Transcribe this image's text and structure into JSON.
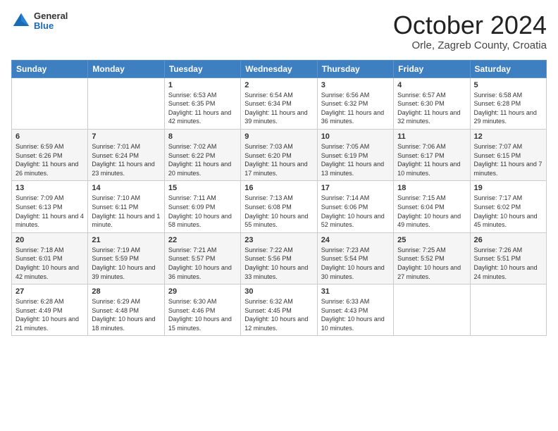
{
  "header": {
    "logo_general": "General",
    "logo_blue": "Blue",
    "month_title": "October 2024",
    "location": "Orle, Zagreb County, Croatia"
  },
  "days_of_week": [
    "Sunday",
    "Monday",
    "Tuesday",
    "Wednesday",
    "Thursday",
    "Friday",
    "Saturday"
  ],
  "weeks": [
    [
      {
        "day": "",
        "sunrise": "",
        "sunset": "",
        "daylight": ""
      },
      {
        "day": "",
        "sunrise": "",
        "sunset": "",
        "daylight": ""
      },
      {
        "day": "1",
        "sunrise": "Sunrise: 6:53 AM",
        "sunset": "Sunset: 6:35 PM",
        "daylight": "Daylight: 11 hours and 42 minutes."
      },
      {
        "day": "2",
        "sunrise": "Sunrise: 6:54 AM",
        "sunset": "Sunset: 6:34 PM",
        "daylight": "Daylight: 11 hours and 39 minutes."
      },
      {
        "day": "3",
        "sunrise": "Sunrise: 6:56 AM",
        "sunset": "Sunset: 6:32 PM",
        "daylight": "Daylight: 11 hours and 36 minutes."
      },
      {
        "day": "4",
        "sunrise": "Sunrise: 6:57 AM",
        "sunset": "Sunset: 6:30 PM",
        "daylight": "Daylight: 11 hours and 32 minutes."
      },
      {
        "day": "5",
        "sunrise": "Sunrise: 6:58 AM",
        "sunset": "Sunset: 6:28 PM",
        "daylight": "Daylight: 11 hours and 29 minutes."
      }
    ],
    [
      {
        "day": "6",
        "sunrise": "Sunrise: 6:59 AM",
        "sunset": "Sunset: 6:26 PM",
        "daylight": "Daylight: 11 hours and 26 minutes."
      },
      {
        "day": "7",
        "sunrise": "Sunrise: 7:01 AM",
        "sunset": "Sunset: 6:24 PM",
        "daylight": "Daylight: 11 hours and 23 minutes."
      },
      {
        "day": "8",
        "sunrise": "Sunrise: 7:02 AM",
        "sunset": "Sunset: 6:22 PM",
        "daylight": "Daylight: 11 hours and 20 minutes."
      },
      {
        "day": "9",
        "sunrise": "Sunrise: 7:03 AM",
        "sunset": "Sunset: 6:20 PM",
        "daylight": "Daylight: 11 hours and 17 minutes."
      },
      {
        "day": "10",
        "sunrise": "Sunrise: 7:05 AM",
        "sunset": "Sunset: 6:19 PM",
        "daylight": "Daylight: 11 hours and 13 minutes."
      },
      {
        "day": "11",
        "sunrise": "Sunrise: 7:06 AM",
        "sunset": "Sunset: 6:17 PM",
        "daylight": "Daylight: 11 hours and 10 minutes."
      },
      {
        "day": "12",
        "sunrise": "Sunrise: 7:07 AM",
        "sunset": "Sunset: 6:15 PM",
        "daylight": "Daylight: 11 hours and 7 minutes."
      }
    ],
    [
      {
        "day": "13",
        "sunrise": "Sunrise: 7:09 AM",
        "sunset": "Sunset: 6:13 PM",
        "daylight": "Daylight: 11 hours and 4 minutes."
      },
      {
        "day": "14",
        "sunrise": "Sunrise: 7:10 AM",
        "sunset": "Sunset: 6:11 PM",
        "daylight": "Daylight: 11 hours and 1 minute."
      },
      {
        "day": "15",
        "sunrise": "Sunrise: 7:11 AM",
        "sunset": "Sunset: 6:09 PM",
        "daylight": "Daylight: 10 hours and 58 minutes."
      },
      {
        "day": "16",
        "sunrise": "Sunrise: 7:13 AM",
        "sunset": "Sunset: 6:08 PM",
        "daylight": "Daylight: 10 hours and 55 minutes."
      },
      {
        "day": "17",
        "sunrise": "Sunrise: 7:14 AM",
        "sunset": "Sunset: 6:06 PM",
        "daylight": "Daylight: 10 hours and 52 minutes."
      },
      {
        "day": "18",
        "sunrise": "Sunrise: 7:15 AM",
        "sunset": "Sunset: 6:04 PM",
        "daylight": "Daylight: 10 hours and 49 minutes."
      },
      {
        "day": "19",
        "sunrise": "Sunrise: 7:17 AM",
        "sunset": "Sunset: 6:02 PM",
        "daylight": "Daylight: 10 hours and 45 minutes."
      }
    ],
    [
      {
        "day": "20",
        "sunrise": "Sunrise: 7:18 AM",
        "sunset": "Sunset: 6:01 PM",
        "daylight": "Daylight: 10 hours and 42 minutes."
      },
      {
        "day": "21",
        "sunrise": "Sunrise: 7:19 AM",
        "sunset": "Sunset: 5:59 PM",
        "daylight": "Daylight: 10 hours and 39 minutes."
      },
      {
        "day": "22",
        "sunrise": "Sunrise: 7:21 AM",
        "sunset": "Sunset: 5:57 PM",
        "daylight": "Daylight: 10 hours and 36 minutes."
      },
      {
        "day": "23",
        "sunrise": "Sunrise: 7:22 AM",
        "sunset": "Sunset: 5:56 PM",
        "daylight": "Daylight: 10 hours and 33 minutes."
      },
      {
        "day": "24",
        "sunrise": "Sunrise: 7:23 AM",
        "sunset": "Sunset: 5:54 PM",
        "daylight": "Daylight: 10 hours and 30 minutes."
      },
      {
        "day": "25",
        "sunrise": "Sunrise: 7:25 AM",
        "sunset": "Sunset: 5:52 PM",
        "daylight": "Daylight: 10 hours and 27 minutes."
      },
      {
        "day": "26",
        "sunrise": "Sunrise: 7:26 AM",
        "sunset": "Sunset: 5:51 PM",
        "daylight": "Daylight: 10 hours and 24 minutes."
      }
    ],
    [
      {
        "day": "27",
        "sunrise": "Sunrise: 6:28 AM",
        "sunset": "Sunset: 4:49 PM",
        "daylight": "Daylight: 10 hours and 21 minutes."
      },
      {
        "day": "28",
        "sunrise": "Sunrise: 6:29 AM",
        "sunset": "Sunset: 4:48 PM",
        "daylight": "Daylight: 10 hours and 18 minutes."
      },
      {
        "day": "29",
        "sunrise": "Sunrise: 6:30 AM",
        "sunset": "Sunset: 4:46 PM",
        "daylight": "Daylight: 10 hours and 15 minutes."
      },
      {
        "day": "30",
        "sunrise": "Sunrise: 6:32 AM",
        "sunset": "Sunset: 4:45 PM",
        "daylight": "Daylight: 10 hours and 12 minutes."
      },
      {
        "day": "31",
        "sunrise": "Sunrise: 6:33 AM",
        "sunset": "Sunset: 4:43 PM",
        "daylight": "Daylight: 10 hours and 10 minutes."
      },
      {
        "day": "",
        "sunrise": "",
        "sunset": "",
        "daylight": ""
      },
      {
        "day": "",
        "sunrise": "",
        "sunset": "",
        "daylight": ""
      }
    ]
  ]
}
